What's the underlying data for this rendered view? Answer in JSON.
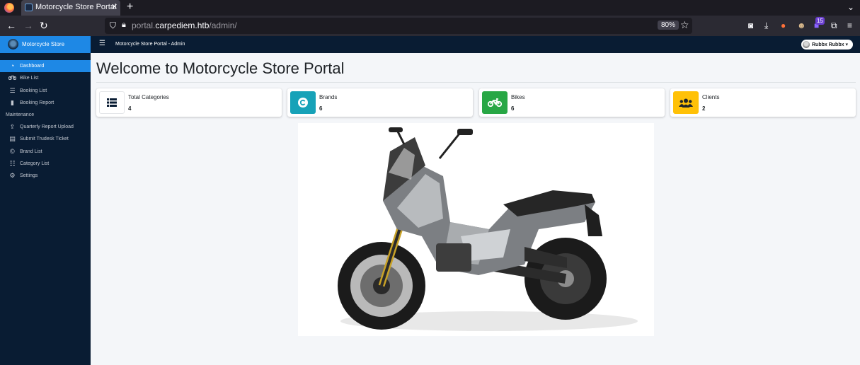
{
  "browser": {
    "tab_title": "Motorcycle Store Portal",
    "tab_close": "✕",
    "new_tab": "+",
    "url_prefix": "portal.",
    "url_host": "carpediem.htb",
    "url_path": "/admin/",
    "zoom": "80%",
    "extension_badge": "15"
  },
  "sidebar": {
    "brand": "Motorcycle Store",
    "items": [
      {
        "label": "Dashboard",
        "icon": "tachometer-icon"
      },
      {
        "label": "Bike List",
        "icon": "motorcycle-icon"
      },
      {
        "label": "Booking List",
        "icon": "list-icon"
      },
      {
        "label": "Booking Report",
        "icon": "file-icon"
      }
    ],
    "section_header": "Maintenance",
    "maintenance_items": [
      {
        "label": "Quarterly Report Upload",
        "icon": "upload-icon"
      },
      {
        "label": "Submit Trudesk Ticket",
        "icon": "ticket-icon"
      },
      {
        "label": "Brand List",
        "icon": "copyright-icon"
      },
      {
        "label": "Category List",
        "icon": "th-list-icon"
      },
      {
        "label": "Settings",
        "icon": "cogs-icon"
      }
    ]
  },
  "topnav": {
    "title": "Motorcycle Store Portal - Admin",
    "user": "Rubbx Rubbx"
  },
  "main": {
    "title": "Welcome to Motorcycle Store Portal",
    "cards": [
      {
        "label": "Total Categories",
        "value": "4",
        "color": "#ffffff",
        "icon": "th-list-icon"
      },
      {
        "label": "Brands",
        "value": "6",
        "color": "#17a2b8",
        "icon": "copyright-icon"
      },
      {
        "label": "Bikes",
        "value": "6",
        "color": "#28a745",
        "icon": "motorcycle-icon"
      },
      {
        "label": "Clients",
        "value": "2",
        "color": "#ffc107",
        "icon": "users-icon"
      }
    ]
  }
}
